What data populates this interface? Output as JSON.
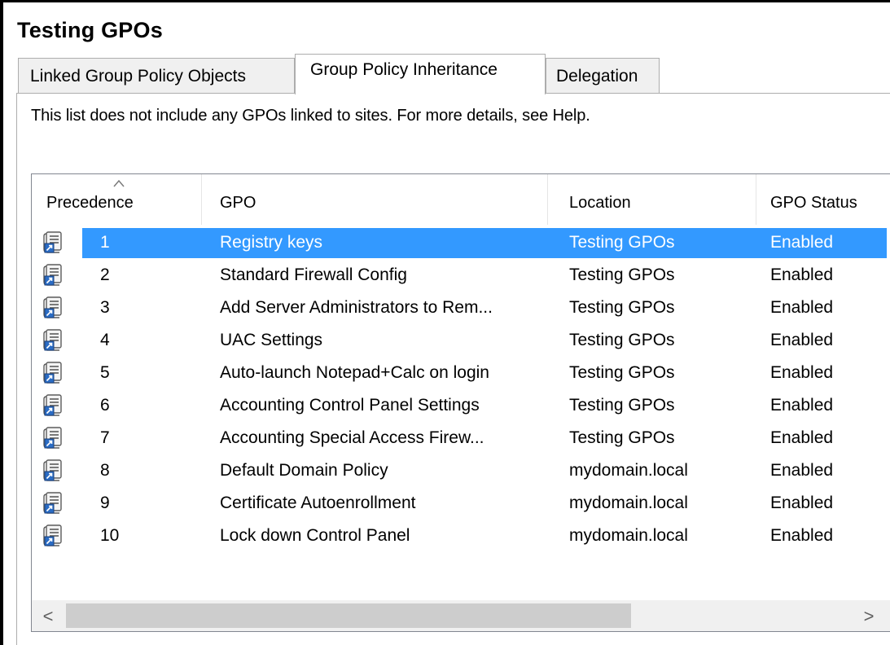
{
  "window": {
    "title": "Testing GPOs"
  },
  "tabs": [
    {
      "label": "Linked Group Policy Objects",
      "active": false
    },
    {
      "label": "Group Policy Inheritance",
      "active": true
    },
    {
      "label": "Delegation",
      "active": false
    }
  ],
  "info_text": "This list does not include any GPOs linked to sites. For more details, see Help.",
  "list": {
    "columns": [
      "Precedence",
      "GPO",
      "Location",
      "GPO Status"
    ],
    "sorted_column": "Precedence",
    "sort_direction": "ascending",
    "selection_color": "#3399ff",
    "row_icon": "gpo-scroll-icon",
    "rows": [
      {
        "precedence": "1",
        "gpo": "Registry keys",
        "location": "Testing GPOs",
        "status": "Enabled",
        "selected": true
      },
      {
        "precedence": "2",
        "gpo": "Standard Firewall Config",
        "location": "Testing GPOs",
        "status": "Enabled"
      },
      {
        "precedence": "3",
        "gpo": "Add Server Administrators to Rem...",
        "location": "Testing GPOs",
        "status": "Enabled"
      },
      {
        "precedence": "4",
        "gpo": "UAC Settings",
        "location": "Testing GPOs",
        "status": "Enabled"
      },
      {
        "precedence": "5",
        "gpo": "Auto-launch Notepad+Calc on login",
        "location": "Testing GPOs",
        "status": "Enabled"
      },
      {
        "precedence": "6",
        "gpo": "Accounting Control Panel Settings",
        "location": "Testing GPOs",
        "status": "Enabled"
      },
      {
        "precedence": "7",
        "gpo": "Accounting Special Access Firew...",
        "location": "Testing GPOs",
        "status": "Enabled"
      },
      {
        "precedence": "8",
        "gpo": "Default Domain Policy",
        "location": "mydomain.local",
        "status": "Enabled"
      },
      {
        "precedence": "9",
        "gpo": "Certificate Autoenrollment",
        "location": "mydomain.local",
        "status": "Enabled"
      },
      {
        "precedence": "10",
        "gpo": "Lock down Control Panel",
        "location": "mydomain.local",
        "status": "Enabled"
      }
    ]
  },
  "scrollbar": {
    "left_arrow": "<",
    "right_arrow": ">"
  }
}
